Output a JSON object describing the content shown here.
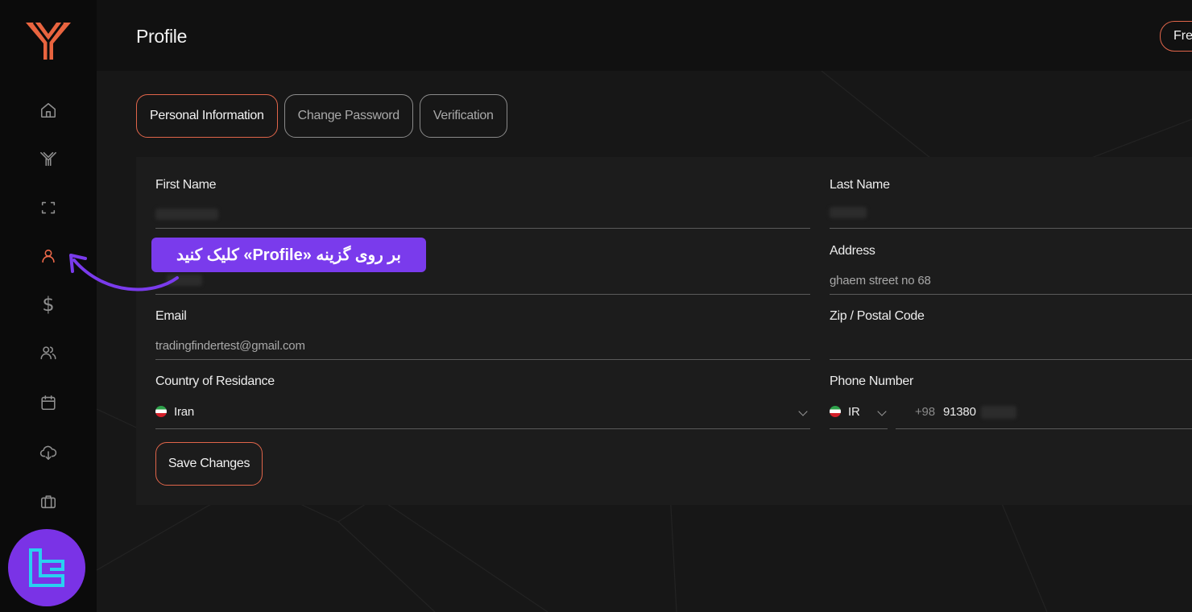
{
  "header": {
    "title": "Profile",
    "top_button_label": "Fre"
  },
  "tabs": [
    {
      "label": "Personal Information",
      "active": true
    },
    {
      "label": "Change Password",
      "active": false
    },
    {
      "label": "Verification",
      "active": false
    }
  ],
  "form": {
    "first_name": {
      "label": "First Name",
      "value": ""
    },
    "last_name": {
      "label": "Last Name",
      "value": ""
    },
    "address": {
      "label": "Address",
      "value": "ghaem street no 68"
    },
    "email": {
      "label": "Email",
      "value": "tradingfindertest@gmail.com"
    },
    "zip": {
      "label": "Zip / Postal Code",
      "value": ""
    },
    "country": {
      "label": "Country of Residance",
      "value": "Iran"
    },
    "phone": {
      "label": "Phone Number",
      "country_code": "IR",
      "dial_code": "+98",
      "number": "91380"
    },
    "save_label": "Save Changes"
  },
  "sidebar": {
    "items": [
      {
        "icon": "home-icon",
        "active": false
      },
      {
        "icon": "brand-icon",
        "active": false
      },
      {
        "icon": "bracket-icon",
        "active": false
      },
      {
        "icon": "user-icon",
        "active": true
      },
      {
        "icon": "dollar-icon",
        "active": false
      },
      {
        "icon": "users-icon",
        "active": false
      },
      {
        "icon": "calendar-icon",
        "active": false
      },
      {
        "icon": "cloud-download-icon",
        "active": false
      },
      {
        "icon": "briefcase-icon",
        "active": false
      }
    ]
  },
  "annotation": {
    "text": "بر روی گزینه «Profile» کلیک کنید"
  },
  "colors": {
    "accent": "#e0654a",
    "annotation": "#7a3bec",
    "background": "#121212"
  }
}
